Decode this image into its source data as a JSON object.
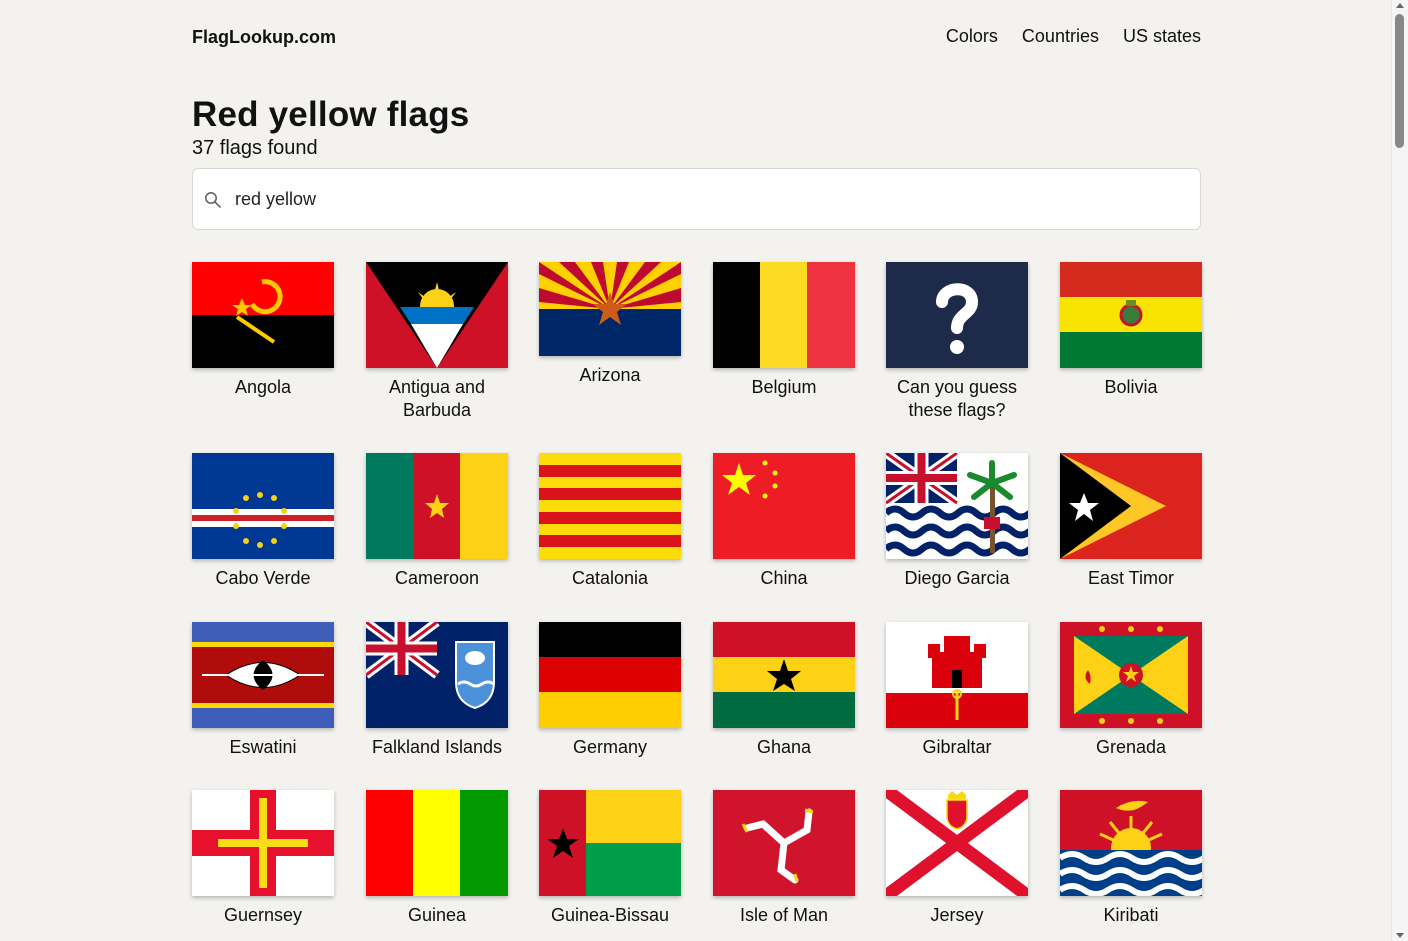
{
  "site": {
    "logo": "FlagLookup.com"
  },
  "nav": {
    "colors": "Colors",
    "countries": "Countries",
    "us_states": "US states"
  },
  "page": {
    "title": "Red yellow flags",
    "count_text": "37 flags found"
  },
  "search": {
    "value": "red yellow"
  },
  "flags": [
    {
      "name": "Angola"
    },
    {
      "name": "Antigua and Barbuda"
    },
    {
      "name": "Arizona"
    },
    {
      "name": "Belgium"
    },
    {
      "name": "Can you guess these flags?"
    },
    {
      "name": "Bolivia"
    },
    {
      "name": "Cabo Verde"
    },
    {
      "name": "Cameroon"
    },
    {
      "name": "Catalonia"
    },
    {
      "name": "China"
    },
    {
      "name": "Diego Garcia"
    },
    {
      "name": "East Timor"
    },
    {
      "name": "Eswatini"
    },
    {
      "name": "Falkland Islands"
    },
    {
      "name": "Germany"
    },
    {
      "name": "Ghana"
    },
    {
      "name": "Gibraltar"
    },
    {
      "name": "Grenada"
    },
    {
      "name": "Guernsey"
    },
    {
      "name": "Guinea"
    },
    {
      "name": "Guinea-Bissau"
    },
    {
      "name": "Isle of Man"
    },
    {
      "name": "Jersey"
    },
    {
      "name": "Kiribati"
    }
  ]
}
